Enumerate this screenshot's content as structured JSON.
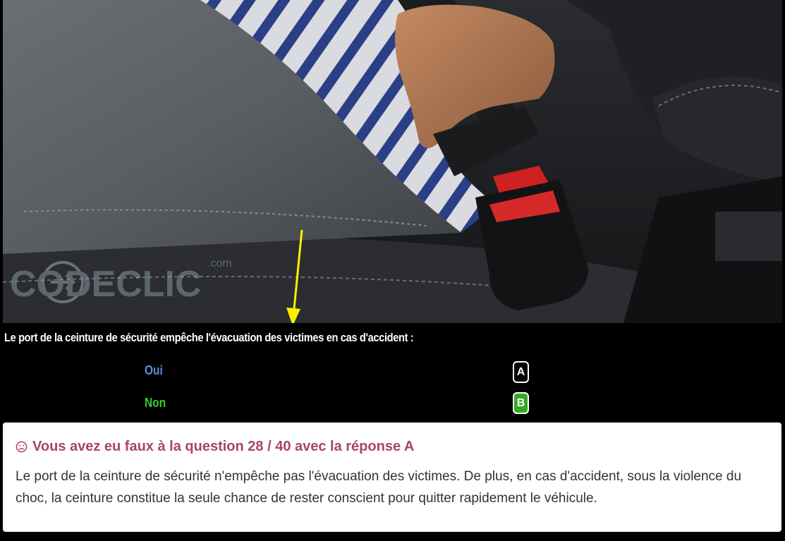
{
  "image": {
    "alt": "",
    "watermark_text": "CODECLIC",
    "watermark_suffix": ".com"
  },
  "question": {
    "text": "Le port de la ceinture de sécurité empêche l'évacuation des victimes en cas d'accident :"
  },
  "answers": [
    {
      "label": "Oui",
      "key": "A",
      "label_color": "#5a8fd8",
      "key_color": "#000000"
    },
    {
      "label": "Non",
      "key": "B",
      "label_color": "#33cc33",
      "key_color": "#33aa22"
    }
  ],
  "feedback": {
    "icon": "frown-face-icon",
    "title": "Vous avez eu faux à la question 28 / 40 avec la réponse A",
    "title_color": "#a94467",
    "body": "Le port de la ceinture de sécurité n'empêche pas l'évacuation des victimes. De plus, en cas d'accident, sous la violence du choc, la ceinture constitue la seule chance de rester conscient pour quitter rapidement le véhicule."
  },
  "colors": {
    "arrow": "#ffee00"
  }
}
